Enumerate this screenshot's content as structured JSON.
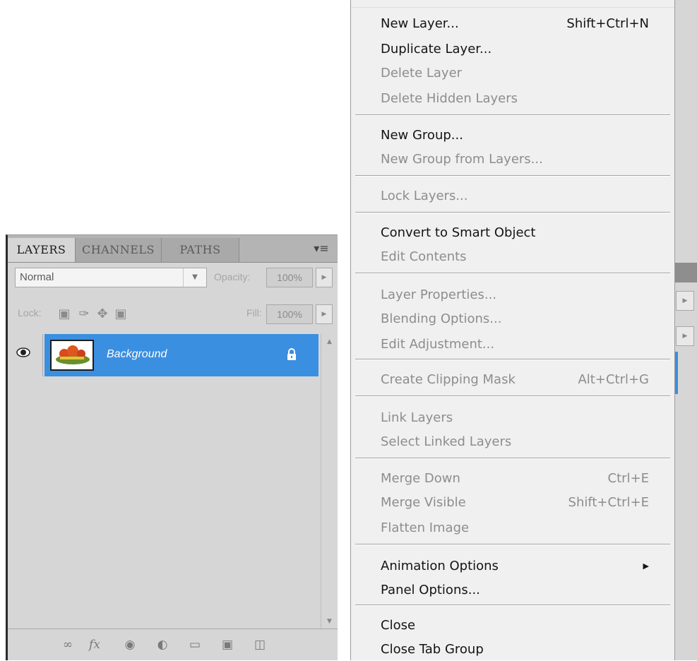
{
  "layers_panel": {
    "tabs": [
      "LAYERS",
      "CHANNELS",
      "PATHS"
    ],
    "panel_menu_icon": "panel-menu-icon",
    "blend_mode": "Normal",
    "opacity_label": "Opacity:",
    "opacity_value": "100%",
    "lock_label": "Lock:",
    "fill_label": "Fill:",
    "fill_value": "100%",
    "layer": {
      "name": "Background",
      "visible": true,
      "locked": true
    },
    "footer_icons": [
      "link-icon",
      "fx-icon",
      "mask-icon",
      "adjustment-icon",
      "group-folder-icon",
      "new-layer-icon",
      "trash-icon"
    ],
    "fx_text": "fx"
  },
  "menu": {
    "items": [
      {
        "label": "New Layer...",
        "shortcut": "Shift+Ctrl+N",
        "enabled": true
      },
      {
        "label": "Duplicate Layer...",
        "shortcut": "",
        "enabled": true
      },
      {
        "label": "Delete Layer",
        "shortcut": "",
        "enabled": false
      },
      {
        "label": "Delete Hidden Layers",
        "shortcut": "",
        "enabled": false
      },
      {
        "label": "New Group...",
        "shortcut": "",
        "enabled": true
      },
      {
        "label": "New Group from Layers...",
        "shortcut": "",
        "enabled": false
      },
      {
        "label": "Lock Layers...",
        "shortcut": "",
        "enabled": false
      },
      {
        "label": "Convert to Smart Object",
        "shortcut": "",
        "enabled": true
      },
      {
        "label": "Edit Contents",
        "shortcut": "",
        "enabled": false
      },
      {
        "label": "Layer Properties...",
        "shortcut": "",
        "enabled": false
      },
      {
        "label": "Blending Options...",
        "shortcut": "",
        "enabled": false
      },
      {
        "label": "Edit Adjustment...",
        "shortcut": "",
        "enabled": false
      },
      {
        "label": "Create Clipping Mask",
        "shortcut": "Alt+Ctrl+G",
        "enabled": false
      },
      {
        "label": "Link Layers",
        "shortcut": "",
        "enabled": false
      },
      {
        "label": "Select Linked Layers",
        "shortcut": "",
        "enabled": false
      },
      {
        "label": "Merge Down",
        "shortcut": "Ctrl+E",
        "enabled": false
      },
      {
        "label": "Merge Visible",
        "shortcut": "Shift+Ctrl+E",
        "enabled": false
      },
      {
        "label": "Flatten Image",
        "shortcut": "",
        "enabled": false
      },
      {
        "label": "Animation Options",
        "shortcut": "",
        "enabled": true,
        "submenu": true
      },
      {
        "label": "Panel Options...",
        "shortcut": "",
        "enabled": true
      },
      {
        "label": "Close",
        "shortcut": "",
        "enabled": true
      },
      {
        "label": "Close Tab Group",
        "shortcut": "",
        "enabled": true
      }
    ]
  },
  "colors": {
    "selection": "#3b8fe0",
    "panel_bg": "#d6d6d6",
    "menu_bg": "#f0f0f0",
    "disabled_text": "#8d8d8d"
  }
}
